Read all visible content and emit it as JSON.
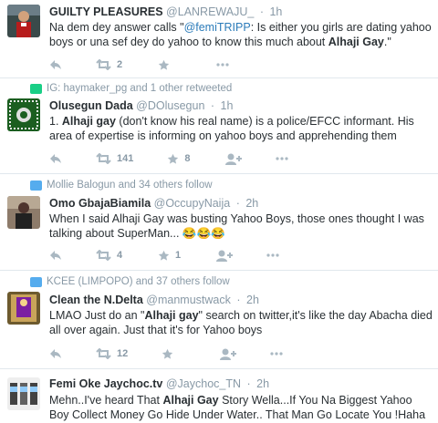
{
  "tweets": [
    {
      "name": "GUILTY PLEASURES",
      "handle": "@LANREWAJU_",
      "time": "1h",
      "text_before": "Na dem dey answer calls \"",
      "mention": "@femiTRIPP",
      "text_mid": ": Is either you girls are dating yahoo boys or una sef dey do yahoo to know this much about ",
      "bold": "Alhaji Gay",
      "text_after": ".\"",
      "retweets": "2",
      "favorites": ""
    },
    {
      "context": "IG: haymaker_pg and 1 other retweeted",
      "name": "Olusegun Dada",
      "handle": "@DOlusegun",
      "time": "1h",
      "text_before": "1. ",
      "bold": "Alhaji gay",
      "text_after": " (don't know his real name) is a police/EFCC informant. His area of expertise is informing on yahoo boys and apprehending them",
      "retweets": "141",
      "favorites": "8"
    },
    {
      "context": "Mollie Balogun and 34 others follow",
      "name": "Omo GbajaBiamila",
      "handle": "@OccupyNaija",
      "time": "2h",
      "text": "When I said Alhaji Gay was busting Yahoo Boys, those ones thought I was talking about SuperMan... 😂😂😂",
      "retweets": "4",
      "favorites": "1"
    },
    {
      "context": "KCEE (LIMPOPO) and 37 others follow",
      "name": "Clean the N.Delta",
      "handle": "@manmustwack",
      "time": "2h",
      "text_before": "LMAO Just do an \"",
      "bold": "Alhaji gay",
      "text_after": "\" search on twitter,it's like the day Abacha died all over again. Just that it's for Yahoo boys",
      "retweets": "12",
      "favorites": ""
    },
    {
      "name": "Femi Oke Jaychoc.tv",
      "handle": "@Jaychoc_TN",
      "time": "2h",
      "text_before": "Mehn..I've heard That ",
      "bold": "Alhaji Gay",
      "text_after": " Story Wella...If You Na Biggest Yahoo Boy Collect Money Go Hide Under Water.. That Man Go Locate You !Haha"
    }
  ],
  "colors": {
    "retweet_green": "#19cf86",
    "follow_blue": "#55acee",
    "muted": "#8899a6",
    "mention": "#2b7bb9"
  }
}
